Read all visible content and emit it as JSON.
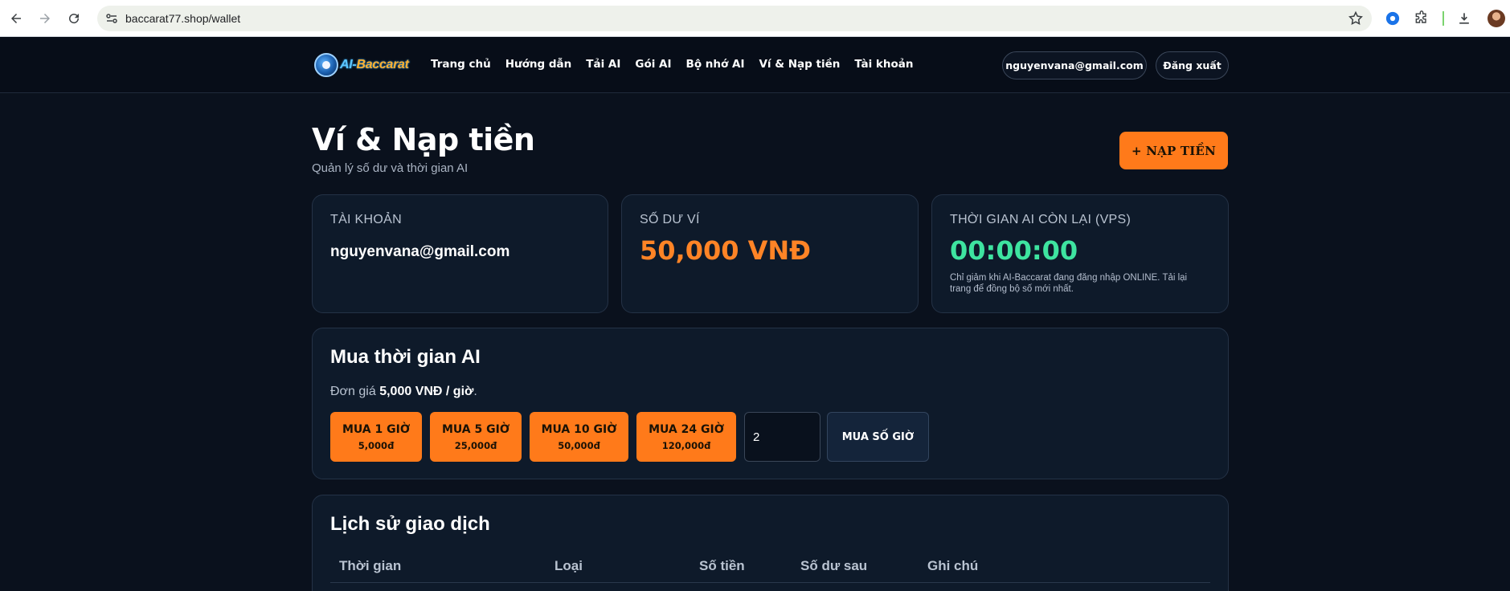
{
  "browser": {
    "url": "baccarat77.shop/wallet"
  },
  "header": {
    "logo_prefix": "AI-",
    "logo_brand": "Baccarat",
    "nav": [
      "Trang chủ",
      "Hướng dẫn",
      "Tải AI",
      "Gói AI",
      "Bộ nhớ AI",
      "Ví & Nạp tiền",
      "Tài khoản"
    ],
    "user_email": "nguyenvana@gmail.com",
    "logout_label": "Đăng xuất"
  },
  "page": {
    "title": "Ví & Nạp tiền",
    "subtitle": "Quản lý số dư và thời gian AI",
    "topup_label": "+ NẠP TIỀN"
  },
  "cards": {
    "account": {
      "label": "TÀI KHOẢN",
      "value": "nguyenvana@gmail.com"
    },
    "balance": {
      "label": "SỐ DƯ VÍ",
      "value": "50,000 VNĐ"
    },
    "ai_time": {
      "label": "THỜI GIAN AI CÒN LẠI (VPS)",
      "value": "00:00:00",
      "note": "Chỉ giảm khi AI-Baccarat đang đăng nhập ONLINE. Tải lại trang để đồng bộ số mới nhất."
    }
  },
  "buy": {
    "title": "Mua thời gian AI",
    "unit_prefix": "Đơn giá",
    "unit_price": "5,000 VNĐ / giờ",
    "unit_suffix": ".",
    "packages": [
      {
        "label": "MUA 1 GIỜ",
        "price": "5,000đ"
      },
      {
        "label": "MUA 5 GIỜ",
        "price": "25,000đ"
      },
      {
        "label": "MUA 10 GIỜ",
        "price": "50,000đ"
      },
      {
        "label": "MUA 24 GIỜ",
        "price": "120,000đ"
      }
    ],
    "hours_value": "2",
    "buy_hours_label": "MUA SỐ GIỜ"
  },
  "history": {
    "title": "Lịch sử giao dịch",
    "columns": [
      "Thời gian",
      "Loại",
      "Số tiền",
      "Số dư sau",
      "Ghi chú"
    ]
  },
  "colors": {
    "accent": "#ff7a1a",
    "balance": "#ff8426",
    "time": "#3ee4a0",
    "background": "#0a111d"
  }
}
